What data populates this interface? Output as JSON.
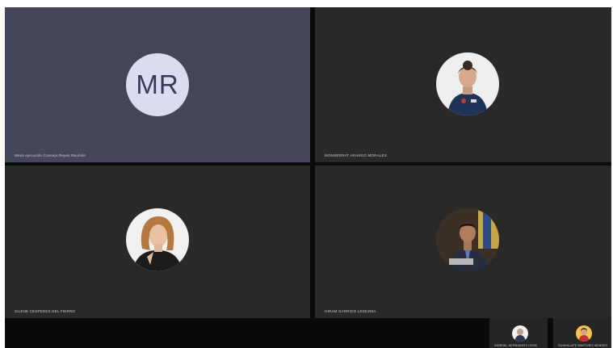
{
  "participants": [
    {
      "initials": "MR",
      "name": "Mesa ejecución Consejo Reyes Reunión",
      "active": true,
      "avatar": "initials-avatar"
    },
    {
      "name": "MONSERRAT ARANGO MORALES",
      "avatar": "woman-uniform-photo"
    },
    {
      "name": "SILENE CESPEDES DEL FIERRO",
      "avatar": "woman-portrait-photo"
    },
    {
      "name": "HIRAM GARRIDO LEDEZMA",
      "avatar": "man-suit-flag-photo"
    }
  ],
  "thumbnails": [
    {
      "name": "GABRIEL HERNANDEZ LEON",
      "avatar": "person-photo"
    },
    {
      "name": "GUADALUPE MARTINEZ MENDEZ",
      "avatar": "person-photo"
    }
  ],
  "colors": {
    "active_tile": "#444659",
    "tile": "#292929",
    "stage": "#0a0a0a",
    "initials_bg": "#dcdcf0",
    "initials_text": "#3a3a5c"
  }
}
